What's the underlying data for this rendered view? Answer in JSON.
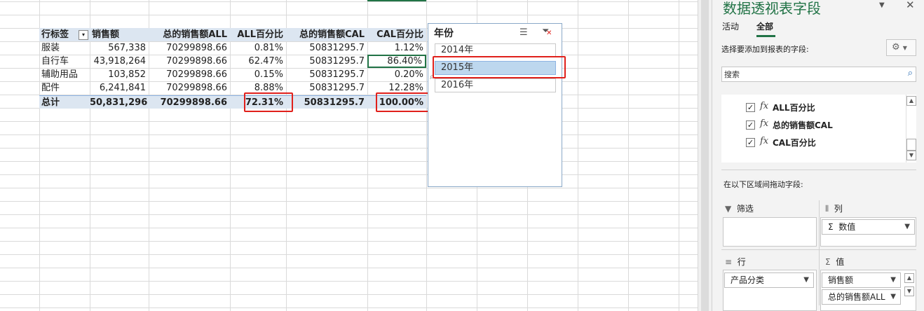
{
  "pivot": {
    "headers": [
      "行标签",
      "销售额",
      "总的销售额ALL",
      "ALL百分比",
      "总的销售额CAL",
      "CAL百分比"
    ],
    "rows": [
      [
        "服装",
        "567,338",
        "70299898.66",
        "0.81%",
        "50831295.7",
        "1.12%"
      ],
      [
        "自行车",
        "43,918,264",
        "70299898.66",
        "62.47%",
        "50831295.7",
        "86.40%"
      ],
      [
        "辅助用品",
        "103,852",
        "70299898.66",
        "0.15%",
        "50831295.7",
        "0.20%"
      ],
      [
        "配件",
        "6,241,841",
        "70299898.66",
        "8.88%",
        "50831295.7",
        "12.28%"
      ]
    ],
    "total": [
      "总计",
      "50,831,296",
      "70299898.66",
      "72.31%",
      "50831295.7",
      "100.00%"
    ]
  },
  "slicer": {
    "title": "年份",
    "items": [
      "2014年",
      "2015年",
      "2016年"
    ],
    "selected_index": 1
  },
  "panel": {
    "title": "数据透视表字段",
    "tabs": [
      "活动",
      "全部"
    ],
    "active_tab": "全部",
    "choose_label": "选择要添加到报表的字段:",
    "search_placeholder": "搜索",
    "fields": [
      {
        "label": "ALL百分比",
        "checked": true
      },
      {
        "label": "总的销售额CAL",
        "checked": true
      },
      {
        "label": "CAL百分比",
        "checked": true
      }
    ],
    "drag_label": "在以下区域间拖动字段:",
    "areas": {
      "filter": {
        "label": "筛选"
      },
      "columns": {
        "label": "列",
        "items": [
          "数值"
        ]
      },
      "rows": {
        "label": "行",
        "items": [
          "产品分类"
        ]
      },
      "values": {
        "label": "值",
        "items": [
          "销售额",
          "总的销售额ALL"
        ]
      }
    }
  },
  "colors": {
    "accent": "#217346",
    "highlight": "#e0201b",
    "header_fill": "#dce6f1"
  }
}
